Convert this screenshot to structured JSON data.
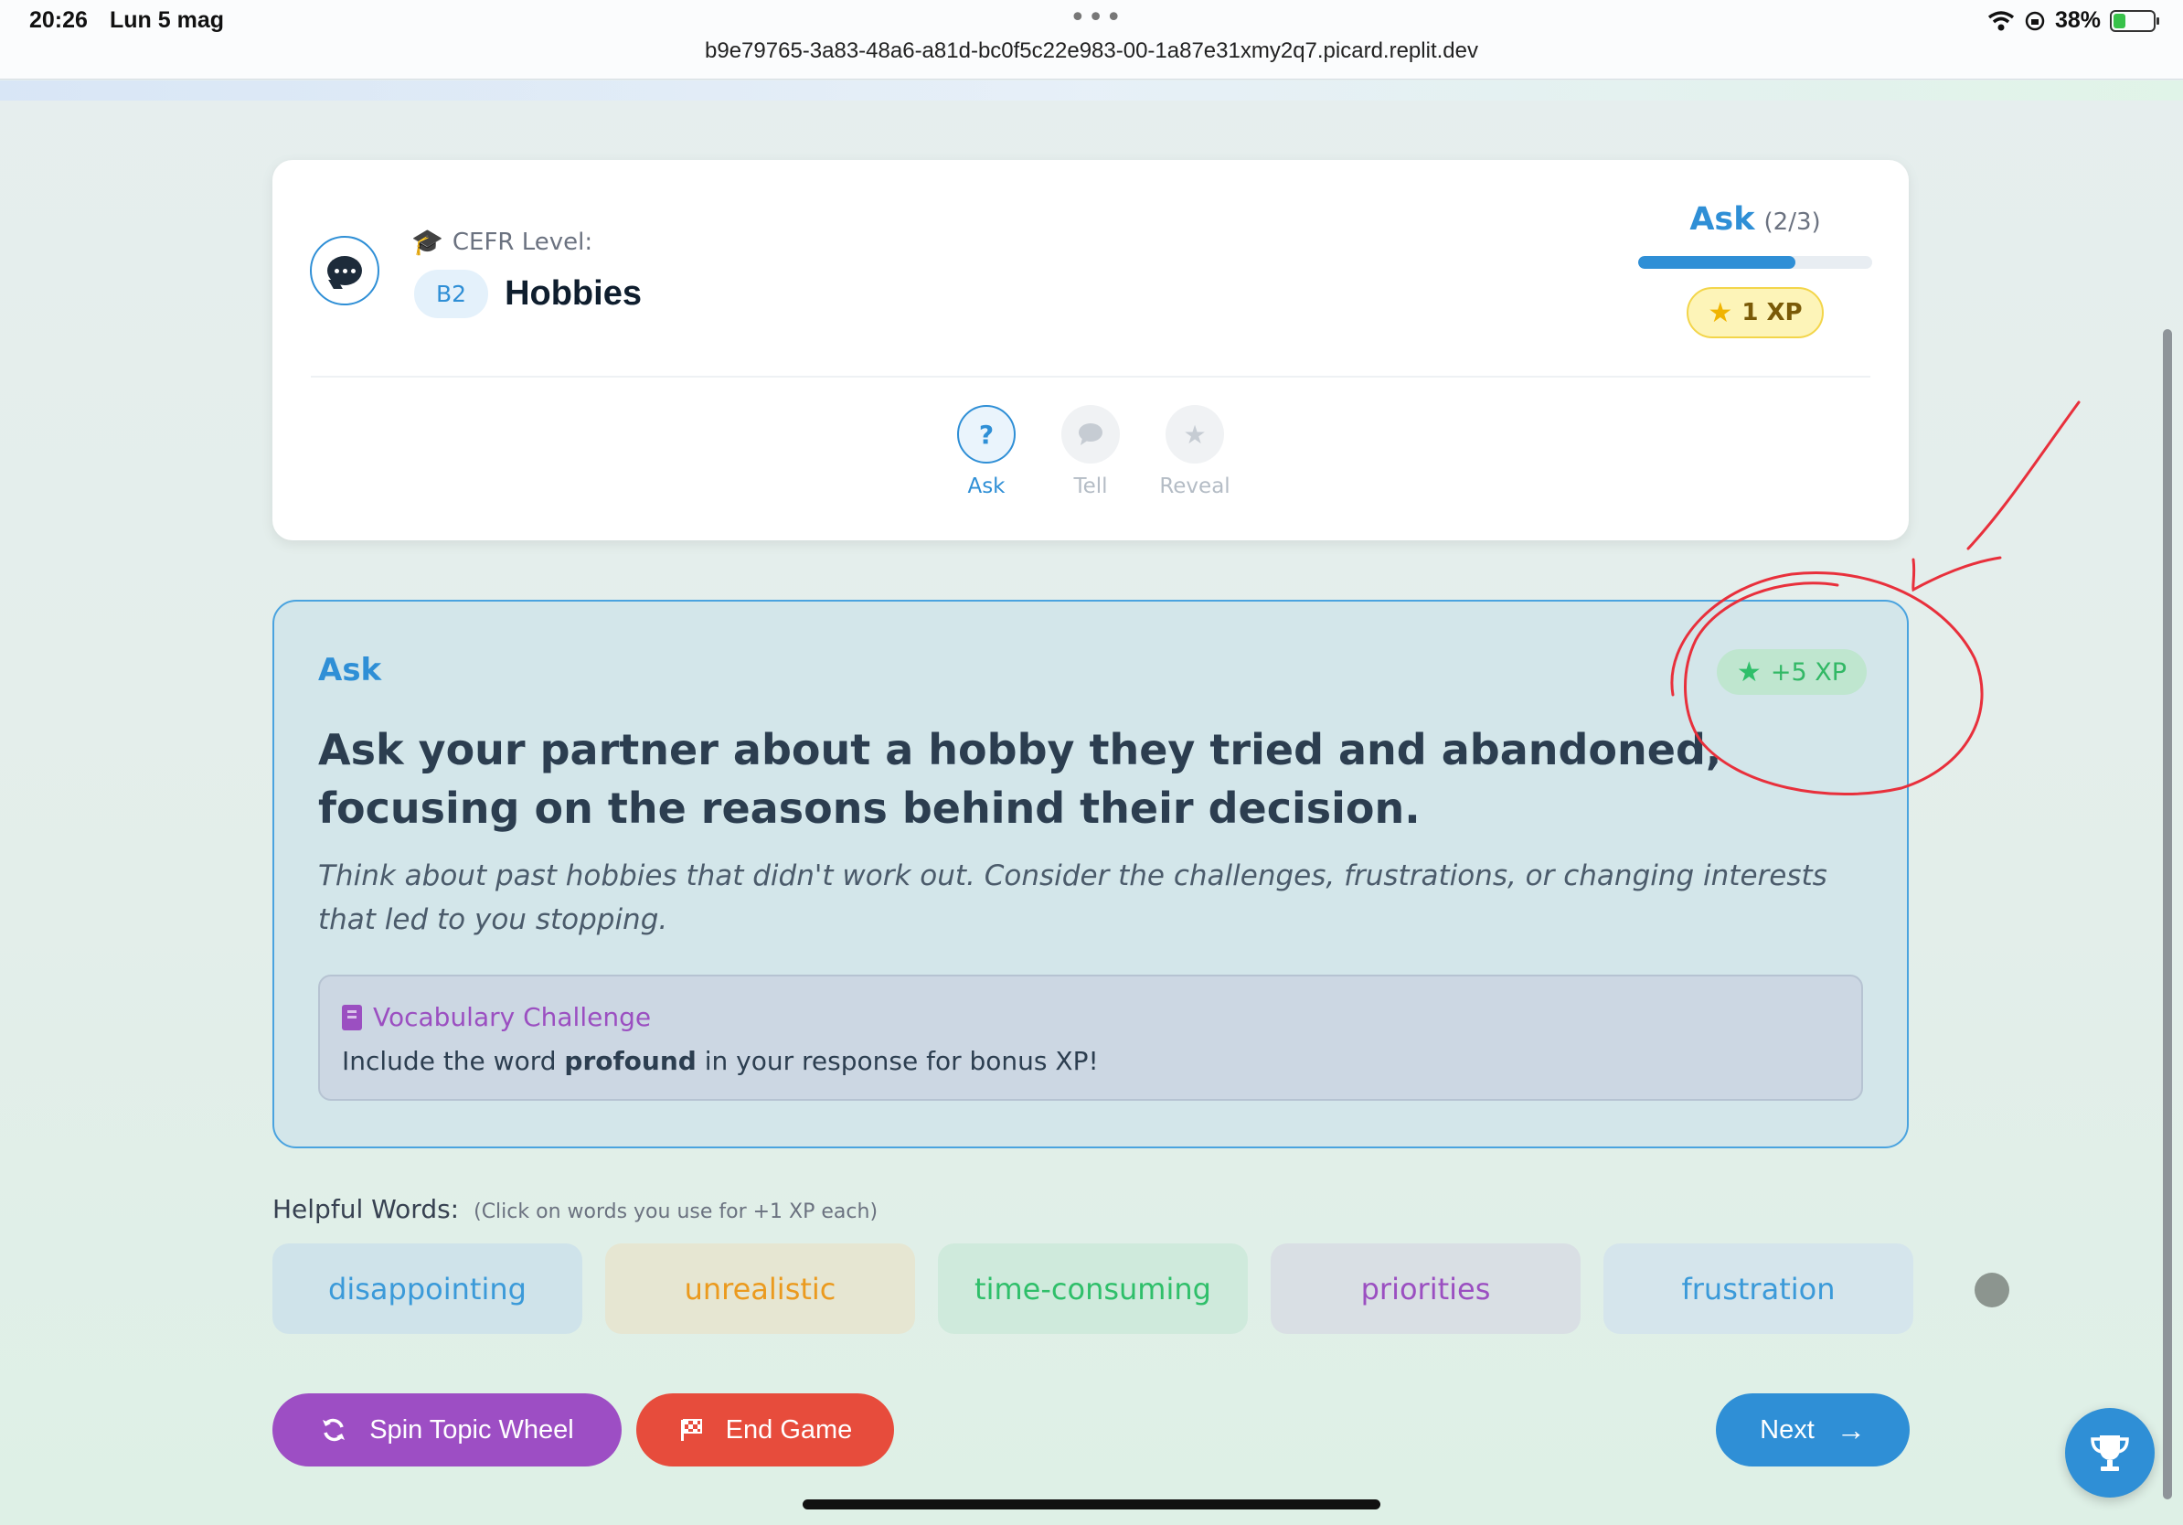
{
  "status_bar": {
    "time": "20:26",
    "date": "Lun 5 mag",
    "url": "b9e79765-3a83-48a6-a81d-bc0f5c22e983-00-1a87e31xmy2q7.picard.replit.dev",
    "battery": "38%",
    "battery_level": 0.38
  },
  "header": {
    "cefr_label": "CEFR Level:",
    "level": "B2",
    "topic": "Hobbies",
    "stage_name": "Ask",
    "stage_count": "(2/3)",
    "stage_progress": 0.67,
    "xp": "1 XP",
    "steps": [
      {
        "label": "Ask",
        "icon": "question-icon",
        "state": "active"
      },
      {
        "label": "Tell",
        "icon": "chat-icon",
        "state": "inactive"
      },
      {
        "label": "Reveal",
        "icon": "star-icon",
        "state": "inactive"
      }
    ]
  },
  "ask_card": {
    "title": "Ask",
    "xp_bonus": "+5 XP",
    "prompt": "Ask your partner about a hobby they tried and abandoned, focusing on the reasons behind their decision.",
    "hint": "Think about past hobbies that didn't work out. Consider the challenges, frustrations, or changing interests that led to you stopping.",
    "vocab_title": "Vocabulary Challenge",
    "vocab_prefix": "Include the word",
    "vocab_word": "profound",
    "vocab_suffix": "in your response for bonus XP!"
  },
  "helpful_words": {
    "label": "Helpful Words:",
    "note": "(Click on words you use for +1 XP each)",
    "words": [
      {
        "text": "disappointing",
        "bg": "#cfe3ea",
        "color": "#3b9ad9"
      },
      {
        "text": "unrealistic",
        "bg": "#e6e6d2",
        "color": "#eb9a1e"
      },
      {
        "text": "time-consuming",
        "bg": "#cfeadc",
        "color": "#2fbf6a"
      },
      {
        "text": "priorities",
        "bg": "#d9dfe4",
        "color": "#9b4fc1"
      },
      {
        "text": "frustration",
        "bg": "#d5e5ec",
        "color": "#3b9ad9"
      }
    ]
  },
  "buttons": {
    "spin": "Spin Topic Wheel",
    "end": "End Game",
    "next": "Next"
  },
  "colors": {
    "accent_blue": "#2f8fd6",
    "purple": "#9d4ec4",
    "red": "#e74c3c",
    "annotation_red": "#e8303c"
  }
}
